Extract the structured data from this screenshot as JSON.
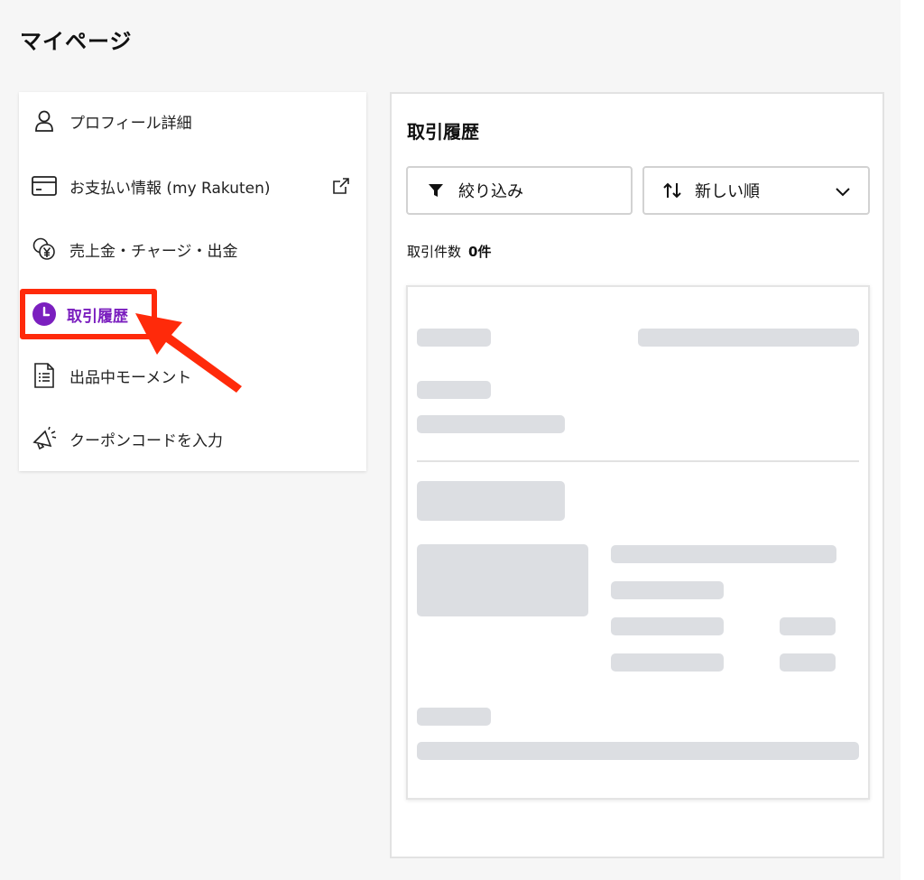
{
  "page": {
    "title": "マイページ"
  },
  "sidebar": {
    "items": [
      {
        "label": "プロフィール詳細",
        "icon": "person-icon"
      },
      {
        "label": "お支払い情報 (my Rakuten)",
        "icon": "credit-card-icon",
        "external": "external-link-icon"
      },
      {
        "label": "売上金・チャージ・出金",
        "icon": "coins-yen-icon"
      },
      {
        "label": "取引履歴",
        "icon": "clock-icon",
        "active": true
      },
      {
        "label": "出品中モーメント",
        "icon": "document-list-icon"
      },
      {
        "label": "クーポンコードを入力",
        "icon": "megaphone-icon"
      }
    ]
  },
  "main": {
    "title": "取引履歴",
    "filter_button": {
      "label": "絞り込み",
      "icon": "filter-icon"
    },
    "sort_select": {
      "label": "新しい順",
      "icon": "sort-arrows-icon"
    },
    "count": {
      "label": "取引件数",
      "value": "0件"
    }
  },
  "colors": {
    "accent": "#7b1fbf",
    "annotation": "#ff2a0a",
    "skeleton": "#dcdee2",
    "background": "#f6f6f6"
  }
}
